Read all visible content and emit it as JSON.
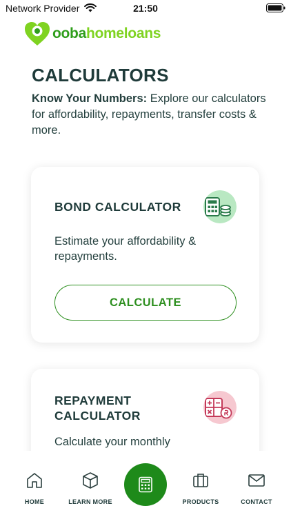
{
  "status": {
    "carrier": "Network Provider",
    "time": "21:50"
  },
  "brand": {
    "prefix": "ooba",
    "suffix": "homeloans",
    "icon": "ooba-heart-logo"
  },
  "page": {
    "title": "CALCULATORS",
    "intro_bold": "Know Your Numbers:",
    "intro_text": " Explore our calculators for affordability, repayments, transfer costs & more."
  },
  "cards": [
    {
      "title": "BOND CALCULATOR",
      "description": "Estimate your affordability & repayments.",
      "button": "CALCULATE",
      "icon": "calculator-coins-icon",
      "accent": "#b9e8c2"
    },
    {
      "title": "REPAYMENT CALCULATOR",
      "description": "Calculate your monthly",
      "icon": "calculator-money-icon",
      "accent": "#f6c8d0"
    }
  ],
  "nav": {
    "home": "HOME",
    "learn": "LEARN MORE",
    "products": "PRODUCTS",
    "contact": "CONTACT"
  },
  "colors": {
    "brand_green": "#2d8f1f",
    "fab_green": "#1e8a1a",
    "text_dark": "#1f3b3a"
  }
}
